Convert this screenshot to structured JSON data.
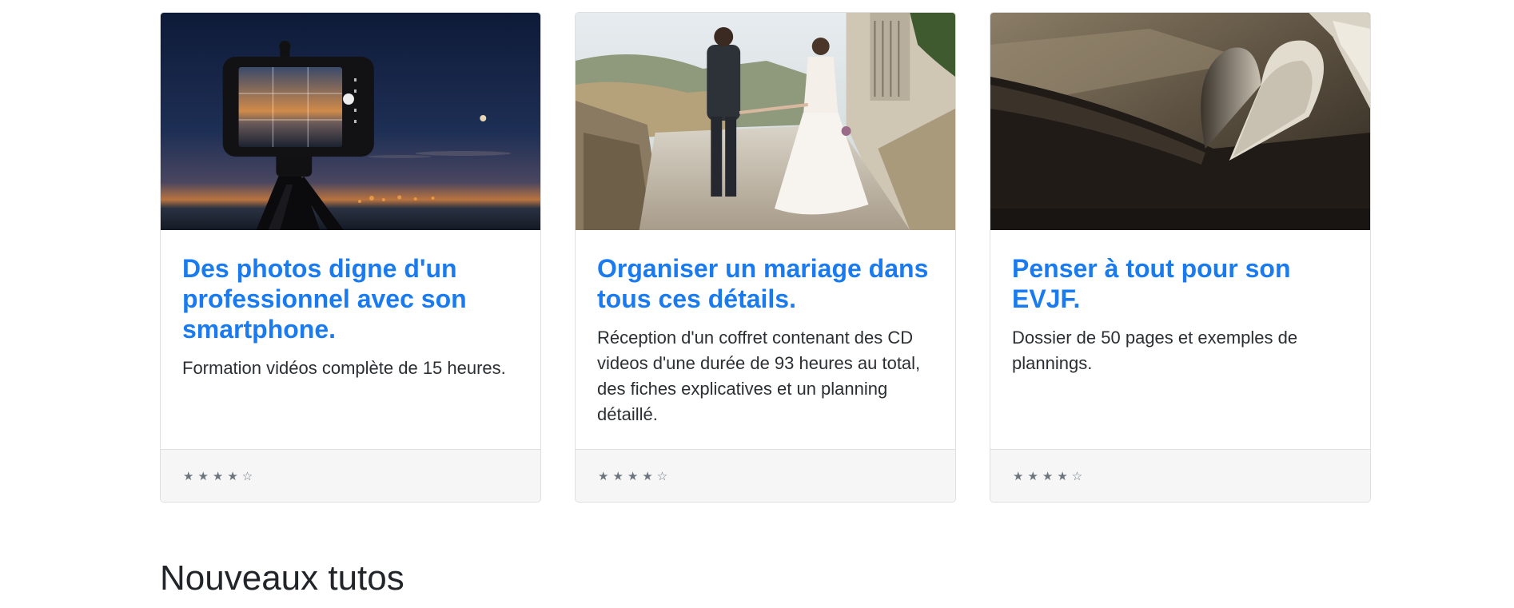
{
  "cards": [
    {
      "image": "camera-smartphone-tripod-at-dusk",
      "title": "Des photos digne d'un professionnel avec son smartphone.",
      "text": "Formation vidéos complète de 15 heures.",
      "rating": 4,
      "stars": "★★★★☆"
    },
    {
      "image": "wedding-couple-walking",
      "title": "Organiser un mariage dans tous ces détails.",
      "text": "Réception d'un coffret contenant des CD videos d'une durée de 93 heures au total, des fiches explicatives et un planning détaillé.",
      "rating": 4,
      "stars": "★★★★☆"
    },
    {
      "image": "book-pages-heart",
      "title": "Penser à tout pour son EVJF.",
      "text": "Dossier de 50 pages et exemples de plannings.",
      "rating": 4,
      "stars": "★★★★☆"
    }
  ],
  "section": {
    "title": "Nouveaux tutos"
  },
  "colors": {
    "title_link": "#1a7bf0",
    "footer_bg": "#f6f6f6",
    "border": "#dfdfdf",
    "stars": "#6c757d"
  }
}
